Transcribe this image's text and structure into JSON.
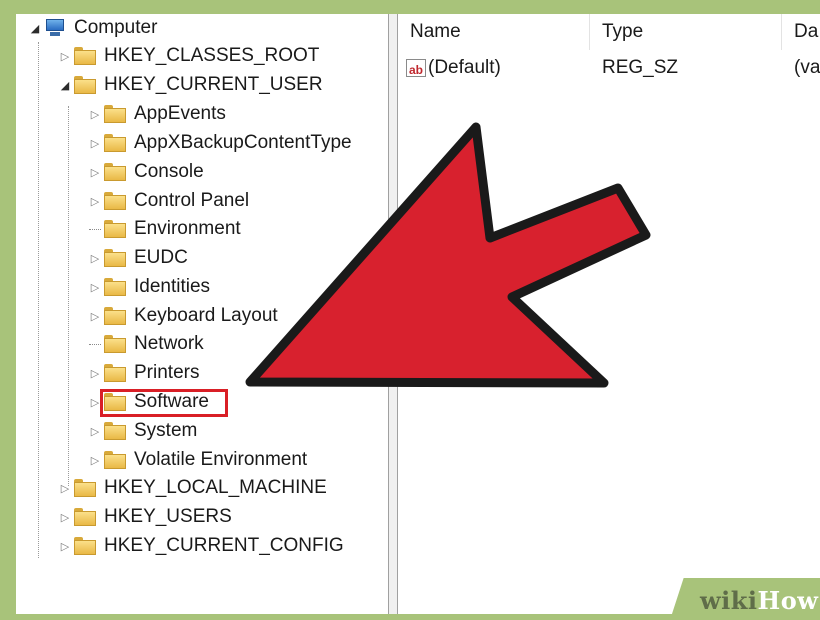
{
  "tree": {
    "root": {
      "label": "Computer",
      "icon": "computer-icon"
    },
    "hives": [
      {
        "label": "HKEY_CLASSES_ROOT",
        "expanded": false
      },
      {
        "label": "HKEY_CURRENT_USER",
        "expanded": true
      }
    ],
    "current_user_children": [
      {
        "label": "AppEvents",
        "has_children": true
      },
      {
        "label": "AppXBackupContentType",
        "has_children": true
      },
      {
        "label": "Console",
        "has_children": true
      },
      {
        "label": "Control Panel",
        "has_children": true
      },
      {
        "label": "Environment",
        "has_children": false
      },
      {
        "label": "EUDC",
        "has_children": true
      },
      {
        "label": "Identities",
        "has_children": true
      },
      {
        "label": "Keyboard Layout",
        "has_children": true
      },
      {
        "label": "Network",
        "has_children": false
      },
      {
        "label": "Printers",
        "has_children": true
      },
      {
        "label": "Software",
        "has_children": true,
        "selected": true
      },
      {
        "label": "System",
        "has_children": true
      },
      {
        "label": "Volatile Environment",
        "has_children": true
      }
    ],
    "other_hives": [
      {
        "label": "HKEY_LOCAL_MACHINE"
      },
      {
        "label": "HKEY_USERS"
      },
      {
        "label": "HKEY_CURRENT_CONFIG"
      }
    ]
  },
  "list": {
    "columns": [
      "Name",
      "Type",
      "Da"
    ],
    "rows": [
      {
        "name": "(Default)",
        "type": "REG_SZ",
        "data": "(va",
        "icon": "string-value-icon",
        "icon_text": "ab"
      }
    ]
  },
  "overlay": {
    "arrow_color": "#d8212e",
    "highlight_color": "#d91f26"
  },
  "watermark": {
    "part1": "wiki",
    "part2": "How"
  }
}
